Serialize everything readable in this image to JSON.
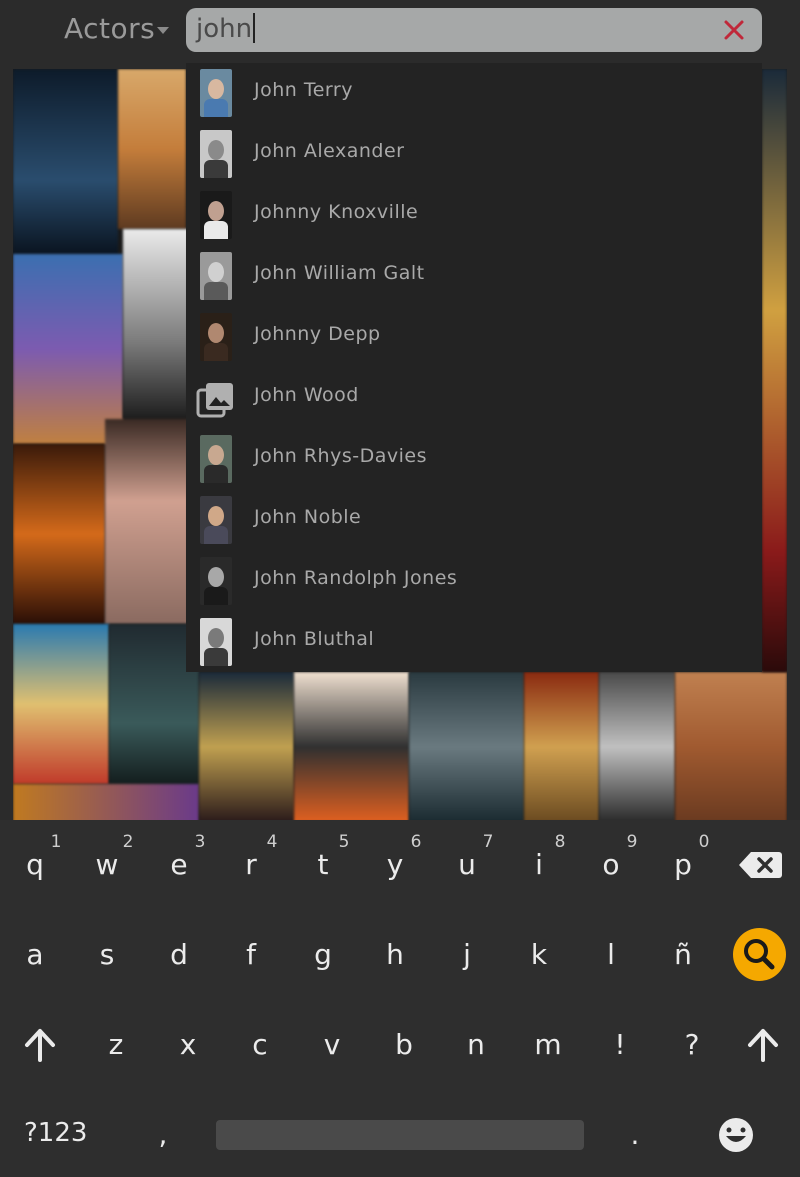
{
  "header": {
    "category": "Actors",
    "search_value": "john",
    "clear_icon": "close-icon"
  },
  "accent": "#f5a800",
  "clear_color": "#c0283a",
  "results": [
    {
      "name": "John Terry",
      "thumb": "photo"
    },
    {
      "name": "John Alexander",
      "thumb": "photo"
    },
    {
      "name": "Johnny Knoxville",
      "thumb": "photo"
    },
    {
      "name": "John William Galt",
      "thumb": "photo"
    },
    {
      "name": "Johnny Depp",
      "thumb": "photo"
    },
    {
      "name": "John Wood",
      "thumb": "image-placeholder-icon"
    },
    {
      "name": "John Rhys-Davies",
      "thumb": "photo"
    },
    {
      "name": "John Noble",
      "thumb": "photo"
    },
    {
      "name": "John Randolph Jones",
      "thumb": "photo"
    },
    {
      "name": "John Bluthal",
      "thumb": "photo"
    }
  ],
  "keyboard": {
    "row1": [
      "q",
      "w",
      "e",
      "r",
      "t",
      "y",
      "u",
      "i",
      "o",
      "p"
    ],
    "row1_hints": [
      "1",
      "2",
      "3",
      "4",
      "5",
      "6",
      "7",
      "8",
      "9",
      "0"
    ],
    "row2": [
      "a",
      "s",
      "d",
      "f",
      "g",
      "h",
      "j",
      "k",
      "l",
      "ñ"
    ],
    "row3": [
      "z",
      "x",
      "c",
      "v",
      "b",
      "n",
      "m",
      "!",
      "?"
    ],
    "symbols_label": "?123",
    "comma": ",",
    "period": ".",
    "backspace_icon": "backspace-icon",
    "search_icon": "search-icon",
    "shift_icon": "shift-icon",
    "emoji_icon": "emoji-icon"
  }
}
